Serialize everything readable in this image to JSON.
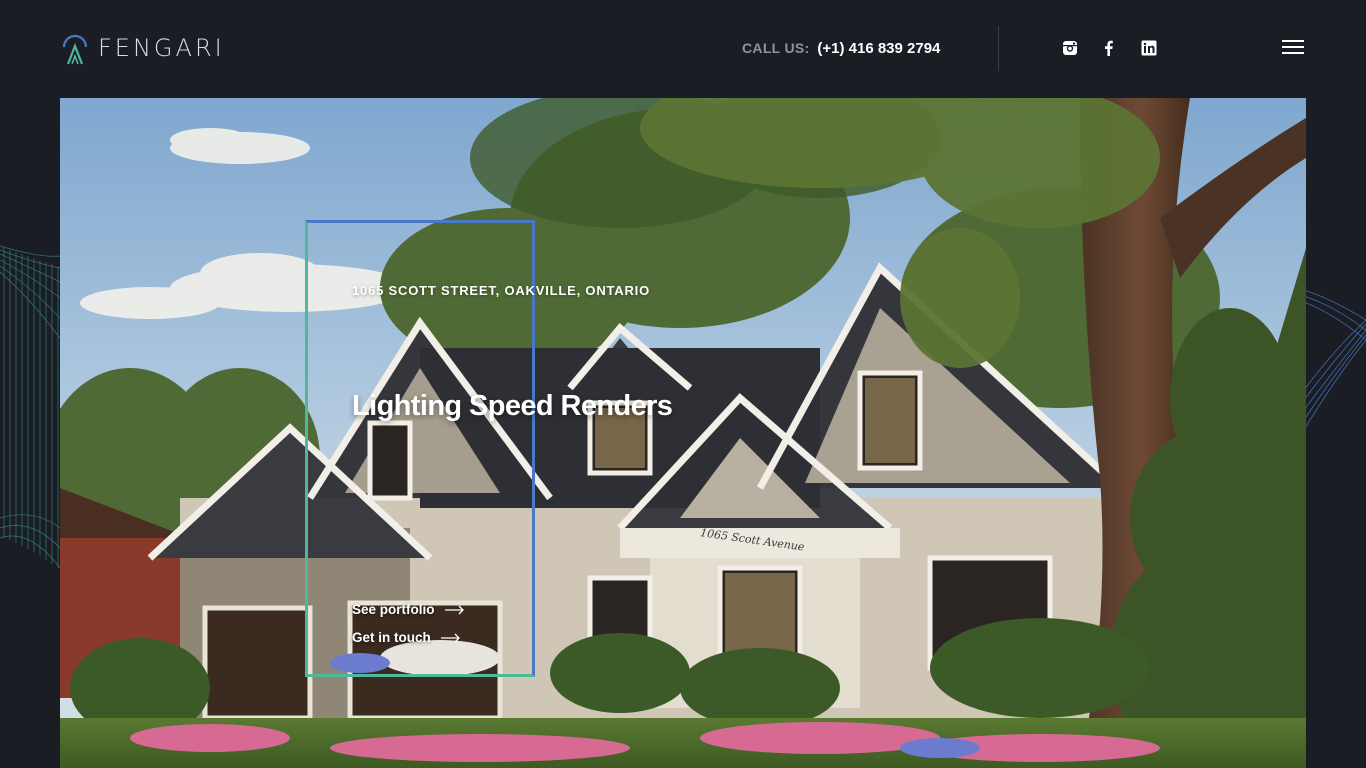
{
  "brand": {
    "name": "FENGARI"
  },
  "header": {
    "call_label": "CALL US:",
    "call_phone": "(+1) 416 839 2794",
    "social": [
      {
        "icon": "instagram-icon"
      },
      {
        "icon": "facebook-icon"
      },
      {
        "icon": "linkedin-icon"
      }
    ],
    "menu_icon": "hamburger-menu-icon"
  },
  "hero": {
    "address": "1065 SCOTT STREET, OAKVILLE, ONTARIO",
    "headline": "Lighting Speed Renders",
    "plaque": "1065 Scott Avenue",
    "links": {
      "portfolio": "See portfolio",
      "contact": "Get in touch"
    }
  },
  "colors": {
    "background": "#1a1e24",
    "frame_blue": "#4a78c8",
    "frame_green": "#4fb89a"
  }
}
